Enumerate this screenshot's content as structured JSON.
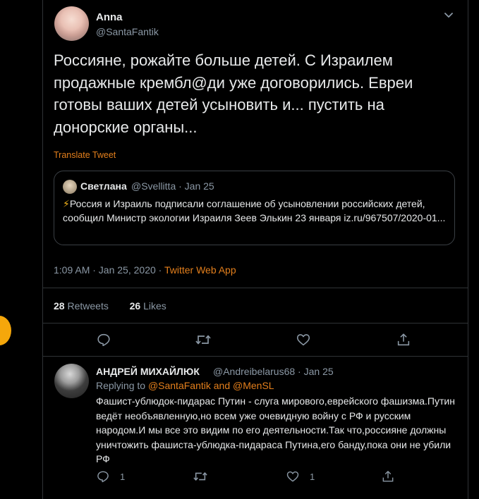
{
  "tweet": {
    "author_name": "Anna",
    "author_handle": "@SantaFantik",
    "text": "Россияне, рожайте больше детей. С Израилем продажные крембл@ди уже договорились. Евреи готовы ваших детей усыновить и... пустить на донорские органы...",
    "translate_label": "Translate Tweet",
    "timestamp": "1:09 AM · Jan 25, 2020 · ",
    "source_app": "Twitter Web App",
    "retweets_count": "28",
    "retweets_label": "Retweets",
    "likes_count": "26",
    "likes_label": "Likes"
  },
  "quoted": {
    "author_name": "Светлана",
    "meta": "@Svellitta · Jan 25",
    "emoji": "⚡",
    "text": "Россия и Израиль подписали соглашение об усыновлении российских детей, сообщил Министр экологии Израиля Зеев Элькин 23 января iz.ru/967507/2020-01..."
  },
  "reply": {
    "author_name": "АНДРЕЙ МИХАЙЛЮК",
    "meta": "@Andreibelarus68 · Jan 25",
    "replying_prefix": "Replying to ",
    "replying_mentions": "@SantaFantik and @MenSL",
    "text": "Фашист-ублюдок-пидарас Путин  -  слуга мирового,еврейского фашизма.Путин ведёт необъявленную,но всем уже очевидную войну с РФ и русским народом.И мы все это видим по его деятельности.Так что,россияне должны уничтожить фашиста-ублюдка-пидараса Путина,его банду,пока они не убили РФ",
    "reply_count": "1",
    "like_count": "1"
  },
  "icons": {
    "reply": "reply-icon",
    "retweet": "retweet-icon",
    "like": "heart-icon",
    "share": "share-icon",
    "more": "chevron-down-icon"
  },
  "colors": {
    "accent": "#e37f1c",
    "background": "#000000",
    "text_primary": "#e7e9ea",
    "text_secondary": "#8b98a5",
    "border": "#2f3336",
    "side_dot": "#f5a70b"
  }
}
